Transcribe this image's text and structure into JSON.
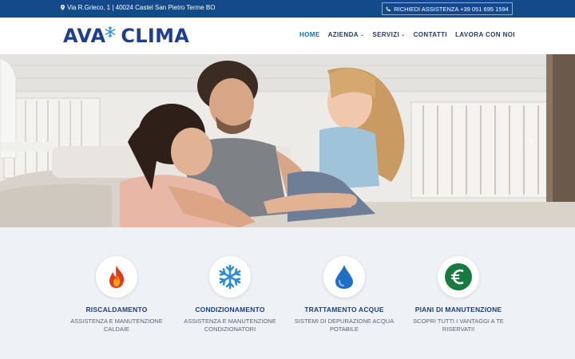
{
  "topbar": {
    "address": "Via R.Grieco, 1 | 40024 Castel San Pietro Terme BO",
    "assist_label": "RICHIEDI ASSISTENZA +39 051 695 1594"
  },
  "header": {
    "logo_text_left": "AVA",
    "logo_text_right": "CLIMA",
    "nav": [
      {
        "label": "HOME"
      },
      {
        "label": "AZIENDA"
      },
      {
        "label": "SERVIZI"
      },
      {
        "label": "CONTATTI"
      },
      {
        "label": "LAVORA CON NOI"
      }
    ]
  },
  "hero": {
    "prev_icon": "chevron-left-icon",
    "next_icon": "chevron-right-icon"
  },
  "services": [
    {
      "title": "RISCALDAMENTO",
      "desc": "ASSISTENZA E MANUTENZIONE CALDAIE",
      "icon": "flame-icon"
    },
    {
      "title": "CONDIZIONAMENTO",
      "desc": "ASSISTENZA E MANUTENZIONE CONDIZIONATORI",
      "icon": "snowflake-icon"
    },
    {
      "title": "TRATTAMENTO ACQUE",
      "desc": "SISTEMI DI DEPURAZIONE ACQUA POTABILE",
      "icon": "water-drop-icon"
    },
    {
      "title": "PIANI DI MANUTENZIONE",
      "desc": "SCOPRI TUTTI I VANTAGGI A TE RISERVATI!",
      "icon": "euro-icon"
    }
  ],
  "colors": {
    "topbar": "#14498a",
    "brand": "#1e3f8f",
    "nav_active": "#1a6bb8",
    "services_bg": "#eef1f6"
  }
}
